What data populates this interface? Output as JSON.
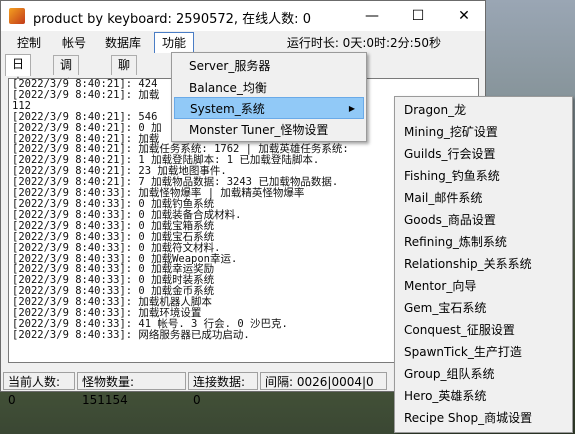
{
  "window": {
    "title": "product by keyboard: 2590572, 在线人数: 0",
    "minimize": "—",
    "maximize": "☐",
    "close": "✕"
  },
  "menubar": {
    "items": [
      "控制",
      "帐号",
      "数据库",
      "功能"
    ],
    "runtime": "运行时长: 0天:0时:2分:50秒"
  },
  "tabs": [
    "日志",
    "调试日志",
    "聊天记"
  ],
  "log": [
    "[2022/3/9 8:40:21]: 424",
    "[2022/3/9 8:40:21]: 加载",
    "112",
    "[2022/3/9 8:40:21]: 546",
    "[2022/3/9 8:40:21]: 0 加",
    "[2022/3/9 8:40:21]: 加载",
    "[2022/3/9 8:40:21]: 加载任务系统: 1762 | 加载英雄任务系统:",
    "[2022/3/9 8:40:21]: 1 加载登陆脚本: 1 已加载登陆脚本.",
    "[2022/3/9 8:40:21]: 23 加载地图事件.",
    "[2022/3/9 8:40:21]: 7 加载物品数据: 3243 已加载物品数据.",
    "[2022/3/9 8:40:33]: 加载怪物爆率 | 加载精英怪物爆率",
    "[2022/3/9 8:40:33]: 0 加载钓鱼系统",
    "[2022/3/9 8:40:33]: 0 加载装备合成材料.",
    "[2022/3/9 8:40:33]: 0 加载宝箱系统",
    "[2022/3/9 8:40:33]: 0 加载宝石系统",
    "[2022/3/9 8:40:33]: 0 加载符文材料.",
    "[2022/3/9 8:40:33]: 0 加载Weapon幸运.",
    "[2022/3/9 8:40:33]: 0 加载幸运奖励",
    "[2022/3/9 8:40:33]: 0 加载时装系统",
    "[2022/3/9 8:40:33]: 0 加载金币系统",
    "[2022/3/9 8:40:33]: 加载机器人脚本",
    "[2022/3/9 8:40:33]: 加载环境设置",
    "[2022/3/9 8:40:33]: 41 帐号. 3 行会. 0 沙巴克.",
    "[2022/3/9 8:40:33]: 网络服务器已成功启动."
  ],
  "status": {
    "online": "当前人数: 0",
    "monsters": "怪物数量: 151154",
    "connections": "连接数据: 0",
    "interval": "间隔: 0026|0004|0"
  },
  "dropdown": {
    "items": [
      "Server_服务器",
      "Balance_均衡",
      "System_系统",
      "Monster Tuner_怪物设置"
    ],
    "arrow": "▶"
  },
  "submenu": {
    "items": [
      "Dragon_龙",
      "Mining_挖矿设置",
      "Guilds_行会设置",
      "Fishing_钓鱼系统",
      "Mail_邮件系统",
      "Goods_商品设置",
      "Refining_炼制系统",
      "Relationship_关系系统",
      "Mentor_向导",
      "Gem_宝石系统",
      "Conquest_征服设置",
      "SpawnTick_生产打造",
      "Group_组队系统",
      "Hero_英雄系统",
      "Recipe Shop_商城设置"
    ]
  }
}
